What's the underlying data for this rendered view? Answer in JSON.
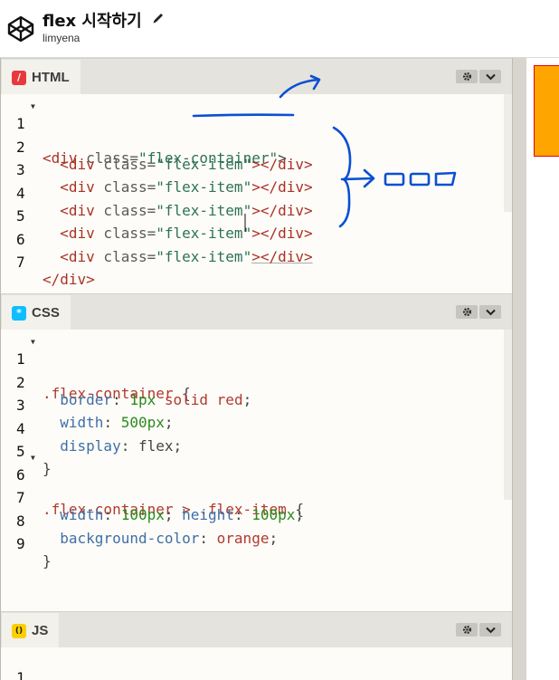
{
  "header": {
    "title": "flex 시작하기",
    "author": "limyena"
  },
  "panels": {
    "html": {
      "label": "HTML",
      "badge": "/",
      "lines": [
        {
          "n": "1",
          "fold": true
        },
        {
          "n": "2"
        },
        {
          "n": "3"
        },
        {
          "n": "4"
        },
        {
          "n": "5"
        },
        {
          "n": "6"
        },
        {
          "n": "7"
        }
      ],
      "code": {
        "l1_open": "<div",
        "l1_attr": " class=",
        "l1_val": "\"flex-container\"",
        "l1_close": ">",
        "item_indent": "  ",
        "item_open": "<div",
        "item_attr": " class=",
        "item_val": "\"flex-item\"",
        "item_close": "></div>",
        "l7": "</div>"
      }
    },
    "css": {
      "label": "CSS",
      "badge": "*",
      "lines": [
        {
          "n": "1",
          "fold": true
        },
        {
          "n": "2"
        },
        {
          "n": "3"
        },
        {
          "n": "4"
        },
        {
          "n": "5"
        },
        {
          "n": "6",
          "fold": true
        },
        {
          "n": "7"
        },
        {
          "n": "8"
        },
        {
          "n": "9"
        }
      ],
      "code": {
        "l1_sel": ".flex-container",
        "l1_brace": " {",
        "l2_prop": "border",
        "l2_num": "1px",
        "l2_rest": " solid ",
        "l2_val": "red",
        "l3_prop": "width",
        "l3_num": "500px",
        "l4_prop": "display",
        "l4_val": "flex",
        "close": "}",
        "l6_sel": ".flex-container > .flex-item",
        "l6_brace": " {",
        "l7_prop1": "width",
        "l7_num1": "100px",
        "l7_prop2": "height",
        "l7_num2": "100px",
        "l8_prop": "background-color",
        "l8_val": "orange",
        "colon": ": ",
        "semi": ";"
      }
    },
    "js": {
      "label": "JS",
      "badge": "()",
      "lines": [
        {
          "n": "1"
        }
      ]
    }
  },
  "icons": {
    "settings": "gear-icon",
    "collapse": "chevron-down-icon",
    "edit": "pencil-icon",
    "logo": "codepen-cube-icon"
  },
  "colors": {
    "preview_box": "#ffa500",
    "preview_border": "#e60000",
    "annotation": "#0a4fd4"
  }
}
